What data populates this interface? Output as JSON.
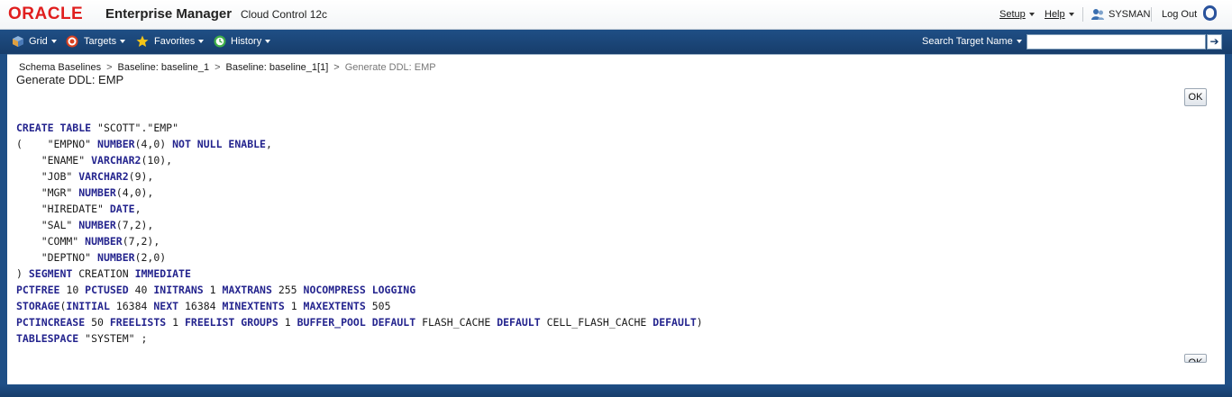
{
  "header": {
    "logo": "ORACLE",
    "product": "Enterprise Manager",
    "subproduct": "Cloud Control 12c",
    "setup_label": "Setup",
    "help_label": "Help",
    "user_label": "SYSMAN",
    "logout_label": "Log Out"
  },
  "nav": {
    "grid_label": "Grid",
    "targets_label": "Targets",
    "favorites_label": "Favorites",
    "history_label": "History",
    "search_label": "Search Target Name",
    "search_value": "",
    "search_go": "➔"
  },
  "breadcrumb": {
    "items": [
      "Schema Baselines",
      "Baseline: baseline_1",
      "Baseline: baseline_1[1]"
    ],
    "current": "Generate DDL: EMP",
    "separator": ">"
  },
  "page": {
    "title": "Generate DDL: EMP",
    "ok_label": "OK"
  },
  "ddl": {
    "lines": [
      [
        [
          "kw",
          "CREATE TABLE "
        ],
        [
          "t",
          "\"SCOTT\".\"EMP\""
        ]
      ],
      [
        [
          "t",
          "(    \"EMPNO\" "
        ],
        [
          "kw",
          "NUMBER"
        ],
        [
          "t",
          "(4,0) "
        ],
        [
          "kw",
          "NOT NULL ENABLE"
        ],
        [
          "t",
          ","
        ]
      ],
      [
        [
          "t",
          "    \"ENAME\" "
        ],
        [
          "kw",
          "VARCHAR2"
        ],
        [
          "t",
          "(10),"
        ]
      ],
      [
        [
          "t",
          "    \"JOB\" "
        ],
        [
          "kw",
          "VARCHAR2"
        ],
        [
          "t",
          "(9),"
        ]
      ],
      [
        [
          "t",
          "    \"MGR\" "
        ],
        [
          "kw",
          "NUMBER"
        ],
        [
          "t",
          "(4,0),"
        ]
      ],
      [
        [
          "t",
          "    \"HIREDATE\" "
        ],
        [
          "kw",
          "DATE"
        ],
        [
          "t",
          ","
        ]
      ],
      [
        [
          "t",
          "    \"SAL\" "
        ],
        [
          "kw",
          "NUMBER"
        ],
        [
          "t",
          "(7,2),"
        ]
      ],
      [
        [
          "t",
          "    \"COMM\" "
        ],
        [
          "kw",
          "NUMBER"
        ],
        [
          "t",
          "(7,2),"
        ]
      ],
      [
        [
          "t",
          "    \"DEPTNO\" "
        ],
        [
          "kw",
          "NUMBER"
        ],
        [
          "t",
          "(2,0)"
        ]
      ],
      [
        [
          "t",
          ") "
        ],
        [
          "kw",
          "SEGMENT"
        ],
        [
          "t",
          " CREATION "
        ],
        [
          "kw",
          "IMMEDIATE"
        ]
      ],
      [
        [
          "kw",
          "PCTFREE"
        ],
        [
          "t",
          " 10 "
        ],
        [
          "kw",
          "PCTUSED"
        ],
        [
          "t",
          " 40 "
        ],
        [
          "kw",
          "INITRANS"
        ],
        [
          "t",
          " 1 "
        ],
        [
          "kw",
          "MAXTRANS"
        ],
        [
          "t",
          " 255 "
        ],
        [
          "kw",
          "NOCOMPRESS LOGGING"
        ]
      ],
      [
        [
          "kw",
          "STORAGE"
        ],
        [
          "t",
          "("
        ],
        [
          "kw",
          "INITIAL"
        ],
        [
          "t",
          " 16384 "
        ],
        [
          "kw",
          "NEXT"
        ],
        [
          "t",
          " 16384 "
        ],
        [
          "kw",
          "MINEXTENTS"
        ],
        [
          "t",
          " 1 "
        ],
        [
          "kw",
          "MAXEXTENTS"
        ],
        [
          "t",
          " 505"
        ]
      ],
      [
        [
          "kw",
          "PCTINCREASE"
        ],
        [
          "t",
          " 50 "
        ],
        [
          "kw",
          "FREELISTS"
        ],
        [
          "t",
          " 1 "
        ],
        [
          "kw",
          "FREELIST GROUPS"
        ],
        [
          "t",
          " 1 "
        ],
        [
          "kw",
          "BUFFER_POOL DEFAULT"
        ],
        [
          "t",
          " FLASH_CACHE "
        ],
        [
          "kw",
          "DEFAULT"
        ],
        [
          "t",
          " CELL_FLASH_CACHE "
        ],
        [
          "kw",
          "DEFAULT"
        ],
        [
          "t",
          ")"
        ]
      ],
      [
        [
          "kw",
          "TABLESPACE"
        ],
        [
          "t",
          " \"SYSTEM\" ;"
        ]
      ]
    ]
  },
  "colors": {
    "nav_background": "#1f4f86",
    "keyword": "#24248e",
    "logo_red": "#e01e1e"
  },
  "icons": {
    "grid": "cube-icon",
    "targets": "target-icon",
    "favorites": "star-icon",
    "history": "clock-icon",
    "user": "user-icon",
    "header_logo": "oracle-ring-icon"
  }
}
